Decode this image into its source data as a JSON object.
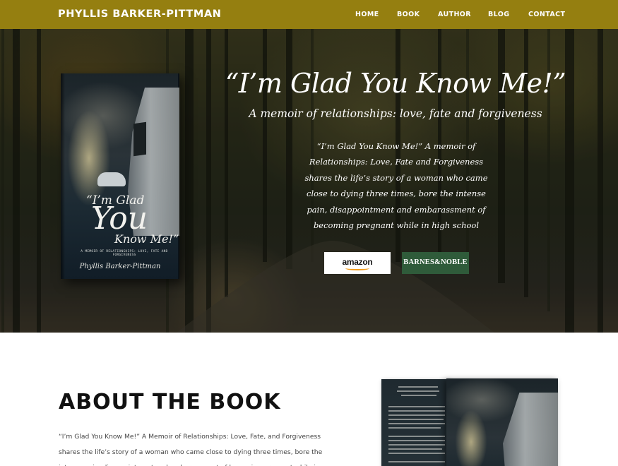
{
  "header": {
    "site_title": "PHYLLIS BARKER-PITTMAN",
    "background_color": "#957f10",
    "nav": [
      {
        "label": "HOME"
      },
      {
        "label": "BOOK"
      },
      {
        "label": "AUTHOR"
      },
      {
        "label": "BLOG"
      },
      {
        "label": "CONTACT"
      }
    ]
  },
  "hero": {
    "title": "“I’m Glad You Know Me!”",
    "subtitle": "A memoir of relationships: love, fate and forgiveness",
    "description": "“I’m Glad You Know Me!” A memoir of Relationships: Love, Fate and Forgiveness shares the life’s story of a woman who came close to dying three times, bore the intense pain, disappointment and embarassment of becoming pregnant while in high school",
    "book_cover": {
      "title_line1": "“I’m Glad",
      "title_line2": "You",
      "title_line3": "Know Me!”",
      "subtitle": "A MEMOIR OF RELATIONSHIPS: LOVE, FATE AND FORGIVENESS",
      "author": "Phyllis Barker-Pittman"
    },
    "buttons": {
      "amazon_label": "amazon",
      "bn_label": "BARNES&NOBLE",
      "bn_color": "#2f5b3a"
    }
  },
  "about": {
    "heading": "ABOUT THE BOOK",
    "text": "“I’m Glad You Know Me!” A Memoir of Relationships: Love, Fate, and Forgiveness shares the life’s story of a woman who came close to dying three times, bore the intense pain, disappointment and embarassment of becoming pregnant while in"
  }
}
